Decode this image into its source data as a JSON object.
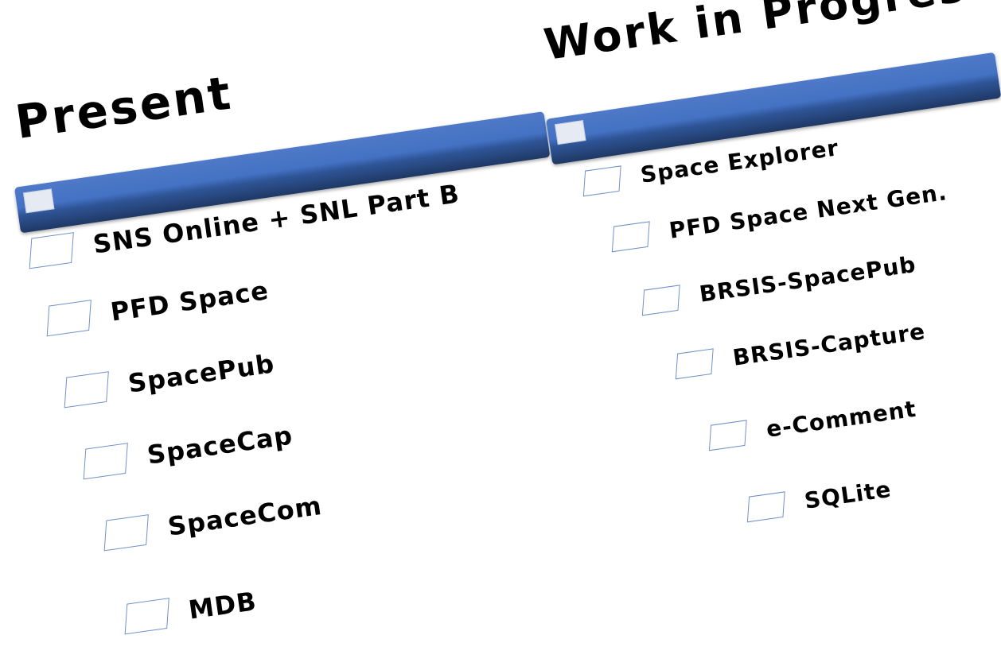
{
  "present": {
    "title": "Present",
    "items": [
      {
        "label": "SNS Online + SNL Part B"
      },
      {
        "label": "PFD Space"
      },
      {
        "label": "SpacePub"
      },
      {
        "label": "SpaceCap"
      },
      {
        "label": "SpaceCom"
      },
      {
        "label": "MDB"
      }
    ]
  },
  "work_in_progress": {
    "title": "Work in Progress",
    "items": [
      {
        "label": "Space Explorer"
      },
      {
        "label": "PFD Space Next Gen."
      },
      {
        "label": "BRSIS-SpacePub"
      },
      {
        "label": "BRSIS-Capture"
      },
      {
        "label": "e-Comment"
      },
      {
        "label": "SQLite"
      }
    ]
  },
  "colors": {
    "bar": "#4472c4",
    "bar_dark": "#1f3864",
    "checkbox_border": "#6f8fc9",
    "text": "#000000"
  }
}
